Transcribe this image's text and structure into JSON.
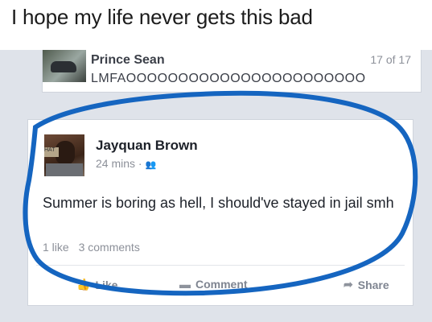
{
  "caption": "I hope my life never gets this bad",
  "message_preview": {
    "sender": "Prince Sean",
    "counter": "17 of 17",
    "text": "LMFAOOOOOOOOOOOOOOOOOOOOOOO"
  },
  "post": {
    "author": "Jayquan Brown",
    "time": "24 mins",
    "separator": "·",
    "audience_icon": "friends-icon",
    "text": "Summer is boring as hell, I should've stayed in jail smh",
    "likes": "1 like",
    "comments": "3 comments"
  },
  "actions": {
    "like": "Like",
    "comment": "Comment",
    "share": "Share"
  },
  "colors": {
    "circle": "#1565c0",
    "feed_bg": "#dfe3ea"
  }
}
